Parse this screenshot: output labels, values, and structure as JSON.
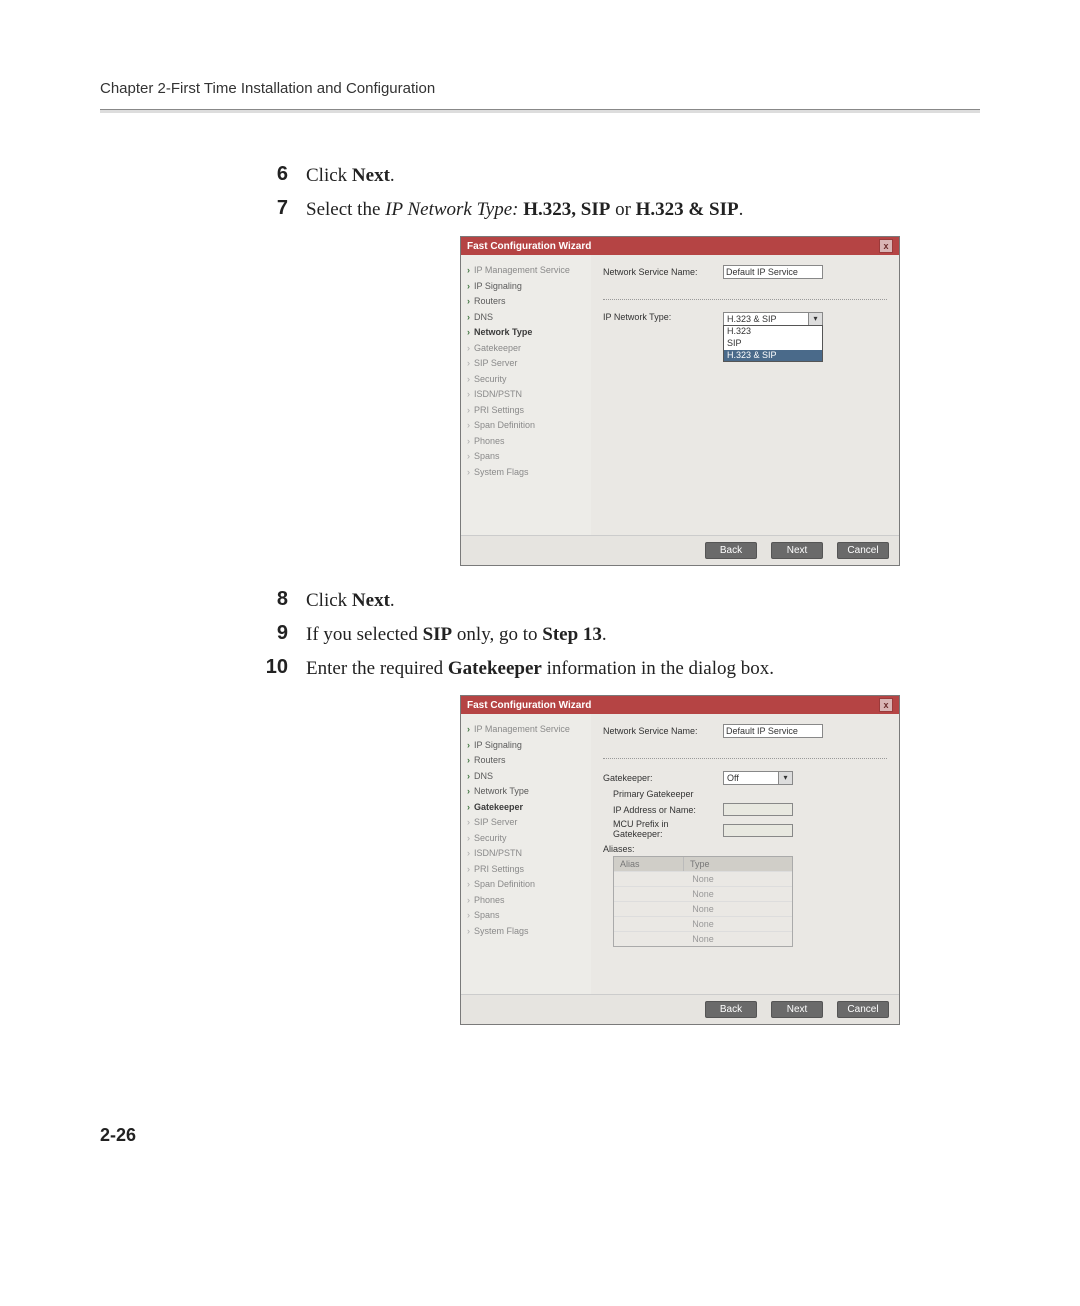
{
  "header": {
    "chapter": "Chapter 2-First Time Installation and Configuration"
  },
  "steps": {
    "s6": {
      "num": "6",
      "prefix": "Click ",
      "bold": "Next",
      "suffix": "."
    },
    "s7": {
      "num": "7",
      "prefix": "Select the ",
      "ital": "IP Network Type:",
      "opts": " H.323, SIP",
      "or": " or ",
      "opt2": "H.323 & SIP",
      "suffix": "."
    },
    "s8": {
      "num": "8",
      "prefix": "Click ",
      "bold": "Next",
      "suffix": "."
    },
    "s9": {
      "num": "9",
      "prefix": "If you selected ",
      "bold1": "SIP",
      "mid": " only, go to ",
      "bold2": "Step 13",
      "suffix": "."
    },
    "s10": {
      "num": "10",
      "prefix": "Enter the required ",
      "bold": "Gatekeeper",
      "suffix": " information in the dialog box."
    }
  },
  "wizard": {
    "title": "Fast Configuration Wizard",
    "close": "x",
    "sidebar": [
      {
        "label": "IP Management Service"
      },
      {
        "label": "IP Signaling"
      },
      {
        "label": "Routers"
      },
      {
        "label": "DNS"
      },
      {
        "label": "Network Type"
      },
      {
        "label": "Gatekeeper"
      },
      {
        "label": "SIP Server"
      },
      {
        "label": "Security"
      },
      {
        "label": "ISDN/PSTN"
      },
      {
        "label": "PRI Settings"
      },
      {
        "label": "Span Definition"
      },
      {
        "label": "Phones"
      },
      {
        "label": "Spans"
      },
      {
        "label": "System Flags"
      }
    ],
    "nsn_label": "Network Service Name:",
    "nsn_value": "Default IP Service",
    "ipnt_label": "IP Network Type:",
    "ipnt_selected": "H.323 & SIP",
    "ipnt_options": [
      "H.323",
      "SIP",
      "H.323 & SIP"
    ],
    "gk_label": "Gatekeeper:",
    "gk_selected": "Off",
    "gk_sub1": "Primary Gatekeeper",
    "gk_ip_label": "IP Address or Name:",
    "gk_prefix_label": "MCU Prefix in Gatekeeper:",
    "aliases_label": "Aliases:",
    "aliases_headers": {
      "c1": "Alias",
      "c2": "Type"
    },
    "aliases_rows": [
      "None",
      "None",
      "None",
      "None",
      "None"
    ],
    "buttons": {
      "back": "Back",
      "next": "Next",
      "cancel": "Cancel"
    }
  },
  "footer": {
    "page": "2-26"
  }
}
